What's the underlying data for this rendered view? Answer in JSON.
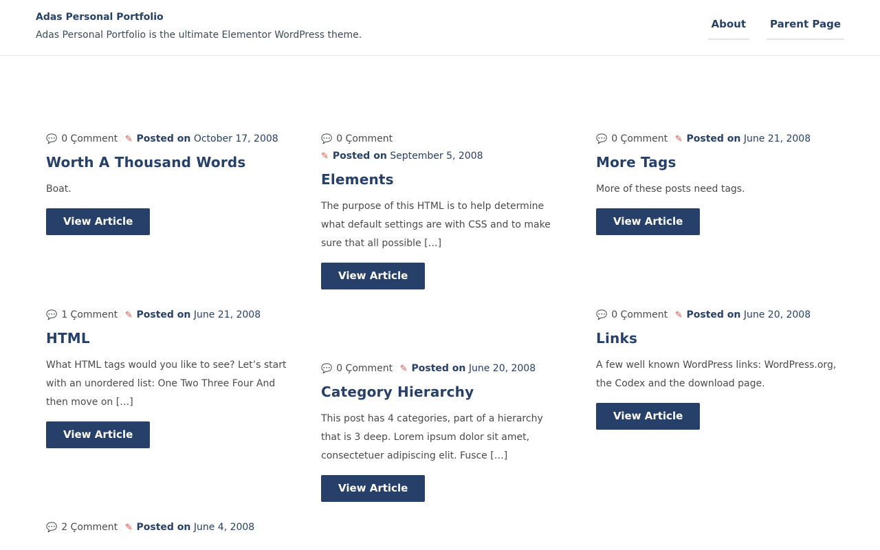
{
  "site": {
    "title": "Adas Personal Portfolio",
    "description": "Adas Personal Portfolio is the ultimate Elementor WordPress theme."
  },
  "nav": {
    "items": [
      {
        "label": "About"
      },
      {
        "label": "Parent Page"
      }
    ]
  },
  "meta_label": "Posted on",
  "button_label": "View Article",
  "icons": {
    "comment": "comments-icon",
    "posted": "pencil-icon"
  },
  "colors": {
    "primary": "#27406a",
    "accent": "#e84c3d",
    "text": "#4a4a4a"
  },
  "posts": [
    {
      "comments": "0 Çomment",
      "date": "October 17, 2008",
      "title": "Worth A Thousand Words",
      "excerpt": "Boat."
    },
    {
      "comments": "0 Çomment",
      "date": "September 5, 2008",
      "title": "Elements",
      "excerpt": "The purpose of this HTML is to help determine what default settings are with CSS and to make sure that all possible […]"
    },
    {
      "comments": "0 Çomment",
      "date": "June 21, 2008",
      "title": "More Tags",
      "excerpt": "More of these posts need tags."
    },
    {
      "comments": "1 Çomment",
      "date": "June 21, 2008",
      "title": "HTML",
      "excerpt": "What HTML tags would you like to see? Let’s start with an unordered list: One Two Three Four And then move on […]"
    },
    {
      "comments": "0 Çomment",
      "date": "June 20, 2008",
      "title": "Category Hierarchy",
      "excerpt": "This post has 4 categories, part of a hierarchy that is 3 deep. Lorem ipsum dolor sit amet, consectetuer adipiscing elit. Fusce […]"
    },
    {
      "comments": "0 Çomment",
      "date": "June 20, 2008",
      "title": "Links",
      "excerpt": "A few well known WordPress links: WordPress.org, the Codex and the download page."
    },
    {
      "comments": "2 Çomment",
      "date": "June 4, 2008"
    }
  ]
}
